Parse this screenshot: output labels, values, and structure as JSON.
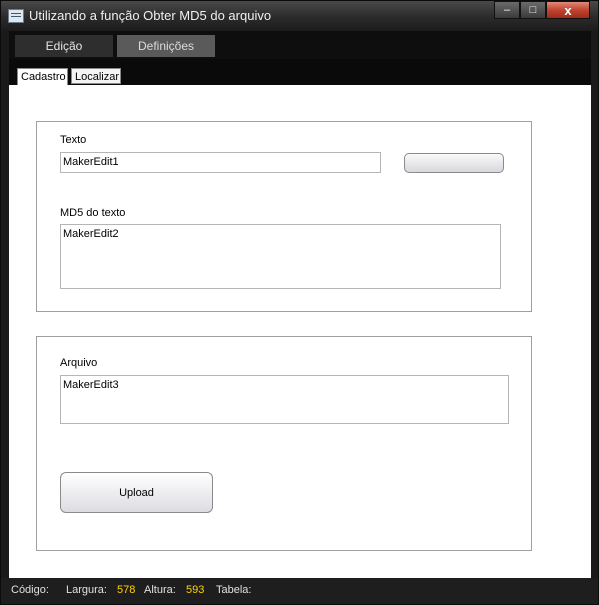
{
  "window": {
    "title": "Utilizando a função Obter MD5 do arquivo",
    "minimize": "–",
    "maximize": "□",
    "close": "x"
  },
  "tabs": {
    "main": [
      "Edição",
      "Definições"
    ],
    "sub": [
      "Cadastro",
      "Localizar"
    ]
  },
  "group1": {
    "text_label": "Texto",
    "edit1": "MakerEdit1",
    "md5_label": "MD5 do texto",
    "edit2": "MakerEdit2"
  },
  "group2": {
    "file_label": "Arquivo",
    "edit3": "MakerEdit3",
    "upload_button": "Upload"
  },
  "status": {
    "codigo_label": "Código:",
    "largura_label": "Largura:",
    "largura_value": "578",
    "altura_label": "Altura:",
    "altura_value": "593",
    "tabela_label": "Tabela:"
  }
}
